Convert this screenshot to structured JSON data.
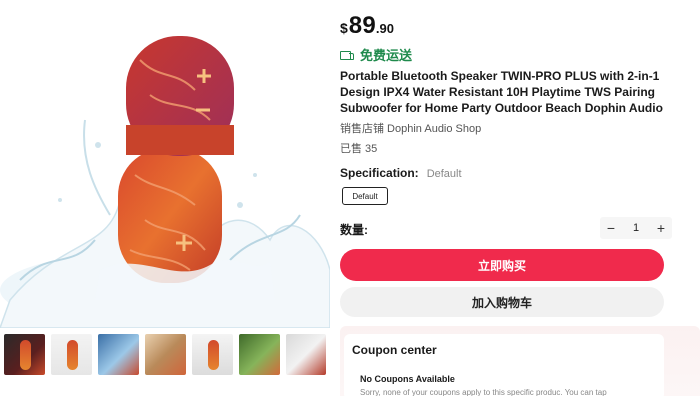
{
  "price": {
    "currency": "$",
    "integer": "89",
    "decimal": ".90"
  },
  "shipping": {
    "label": "免费运送",
    "icon": "truck-icon"
  },
  "product": {
    "title": "Portable Bluetooth Speaker TWIN-PRO PLUS with 2-in-1 Design IPX4 Water Resistant 10H Playtime TWS Pairing Subwoofer for Home Party Outdoor Beach Dophin Audio",
    "shop": "销售店铺 Dophin Audio Shop",
    "sold": "已售 35"
  },
  "specification": {
    "label": "Specification:",
    "value": "Default",
    "option": "Default"
  },
  "quantity": {
    "label": "数量:",
    "value": "1",
    "minus": "−",
    "plus": "+"
  },
  "actions": {
    "buy_now": "立即购买",
    "add_to_cart": "加入购物车"
  },
  "coupons": {
    "title": "Coupon center",
    "empty_title": "No Coupons Available",
    "empty_note": "Sorry, none of your coupons apply to this specific produc. You can tap"
  },
  "colors": {
    "accent": "#f02a4c",
    "shipping_green": "#1f8a4c",
    "chip_border": "#222222"
  },
  "gallery": {
    "thumbnail_count": 7
  }
}
